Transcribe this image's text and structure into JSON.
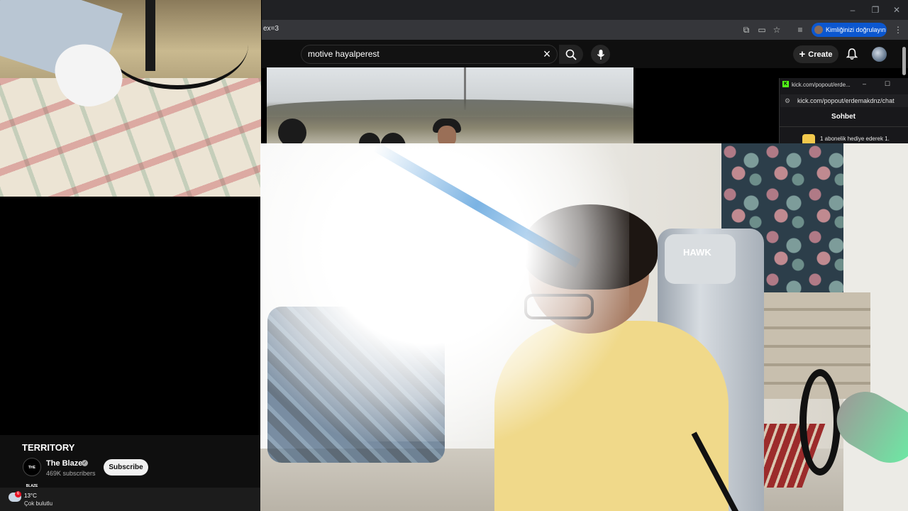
{
  "browser": {
    "url_fragment": "ex=3",
    "profile_chip_label": "Kimliğinizi doğrulayın"
  },
  "youtube": {
    "search_value": "motive hayalperest",
    "create_label": "Create",
    "video": {
      "title": "TERRITORY",
      "channel_name": "The Blaze",
      "channel_logo_text": "THE BLAZE",
      "subscribers": "469K subscribers",
      "subscribe_label": "Subscribe"
    }
  },
  "kick_popout": {
    "window_title": "kick.com/popout/erde...",
    "url": "kick.com/popout/erdemakdnz/chat",
    "heading": "Sohbet",
    "message": "1 abonelik hediye ederek 1."
  },
  "webcam": {
    "chair_brand": "HAWK"
  },
  "taskbar": {
    "weather_badge": "6",
    "temperature": "13°C",
    "condition": "Çok bulutlu"
  },
  "icons": {
    "search": "search-icon",
    "clear": "close-icon",
    "mic": "mic-icon",
    "bell": "bell-icon",
    "create": "plus-icon"
  },
  "colors": {
    "youtube_bg": "#0f0f0f",
    "profile_chip": "#0b57d0",
    "kick_green": "#53fc18"
  }
}
